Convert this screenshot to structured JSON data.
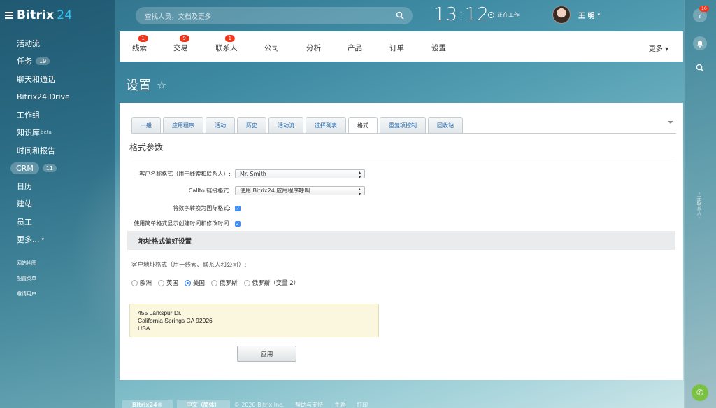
{
  "brand": {
    "name": "Bitrix",
    "num": "24"
  },
  "sidebar": {
    "items": [
      {
        "label": "活动流"
      },
      {
        "label": "任务",
        "count": "19"
      },
      {
        "label": "聊天和通话"
      },
      {
        "label": "Bitrix24.Drive"
      },
      {
        "label": "工作组"
      },
      {
        "label": "知识库",
        "sup": "beta"
      },
      {
        "label": "时间和报告"
      },
      {
        "label": "CRM",
        "count": "11"
      },
      {
        "label": "日历"
      },
      {
        "label": "建站"
      },
      {
        "label": "员工"
      },
      {
        "label": "更多...",
        "arrow": "▾"
      }
    ],
    "small_links": [
      "网站地图",
      "配置菜单",
      "邀请用户"
    ]
  },
  "header": {
    "search_placeholder": "查找人员，文档及更多",
    "clock": "13:12",
    "work_status": "正在工作",
    "user_name": "王 明",
    "user_arrow": "▾"
  },
  "right_rail": {
    "help_badge": "16",
    "help_glyph": "?",
    "bell_glyph": "🔔",
    "search_glyph": "⚲",
    "vertical_text": "- 无联系人 -",
    "phone_glyph": "✆"
  },
  "top_menu": {
    "items": [
      {
        "label": "线索",
        "badge": "1"
      },
      {
        "label": "交易",
        "badge": "9"
      },
      {
        "label": "联系人",
        "badge": "1"
      },
      {
        "label": "公司"
      },
      {
        "label": "分析"
      },
      {
        "label": "产品"
      },
      {
        "label": "订单"
      },
      {
        "label": "设置"
      }
    ],
    "more": "更多 ▾"
  },
  "page": {
    "title": "设置",
    "star": "☆"
  },
  "tabs": [
    "一般",
    "应用程序",
    "活动",
    "历史",
    "活动流",
    "选择列表",
    "格式",
    "重复项控制",
    "回收站"
  ],
  "active_tab": "格式",
  "format": {
    "section_title": "格式参数",
    "name_format_label": "客户名称格式（用于线索和联系人）:",
    "name_format_value": "Mr. Smith",
    "callto_label": "Callto 链接格式:",
    "callto_value": "使用 Bitrix24 应用程序呼叫",
    "intl_label": "将数字转换为国际格式:",
    "simple_time_label": "使用简单格式显示创建时间和修改时间:",
    "check_glyph": "✓"
  },
  "address": {
    "header": "地址格式偏好设置",
    "label": "客户地址格式（用于线索、联系人和公司）:",
    "options": [
      {
        "label": "欧洲",
        "selected": false
      },
      {
        "label": "英国",
        "selected": false
      },
      {
        "label": "美国",
        "selected": true
      },
      {
        "label": "俄罗斯",
        "selected": false
      },
      {
        "label": "俄罗斯（变量 2）",
        "selected": false
      }
    ],
    "preview_lines": [
      "455 Larkspur Dr.",
      "California Springs CA 92926",
      "USA"
    ],
    "apply_label": "应用"
  },
  "footer": {
    "btn1": "Bitrix24®",
    "btn2": "中文（简体）",
    "copyright": "© 2020 Bitrix Inc.",
    "links": [
      "帮助与支持",
      "主题",
      "打印"
    ]
  },
  "colors": {
    "accent": "#2067b0",
    "badge": "#f0371b",
    "logo_num": "#2fc6f6",
    "checkbox": "#3d8ef4",
    "phone": "#7cc242"
  }
}
